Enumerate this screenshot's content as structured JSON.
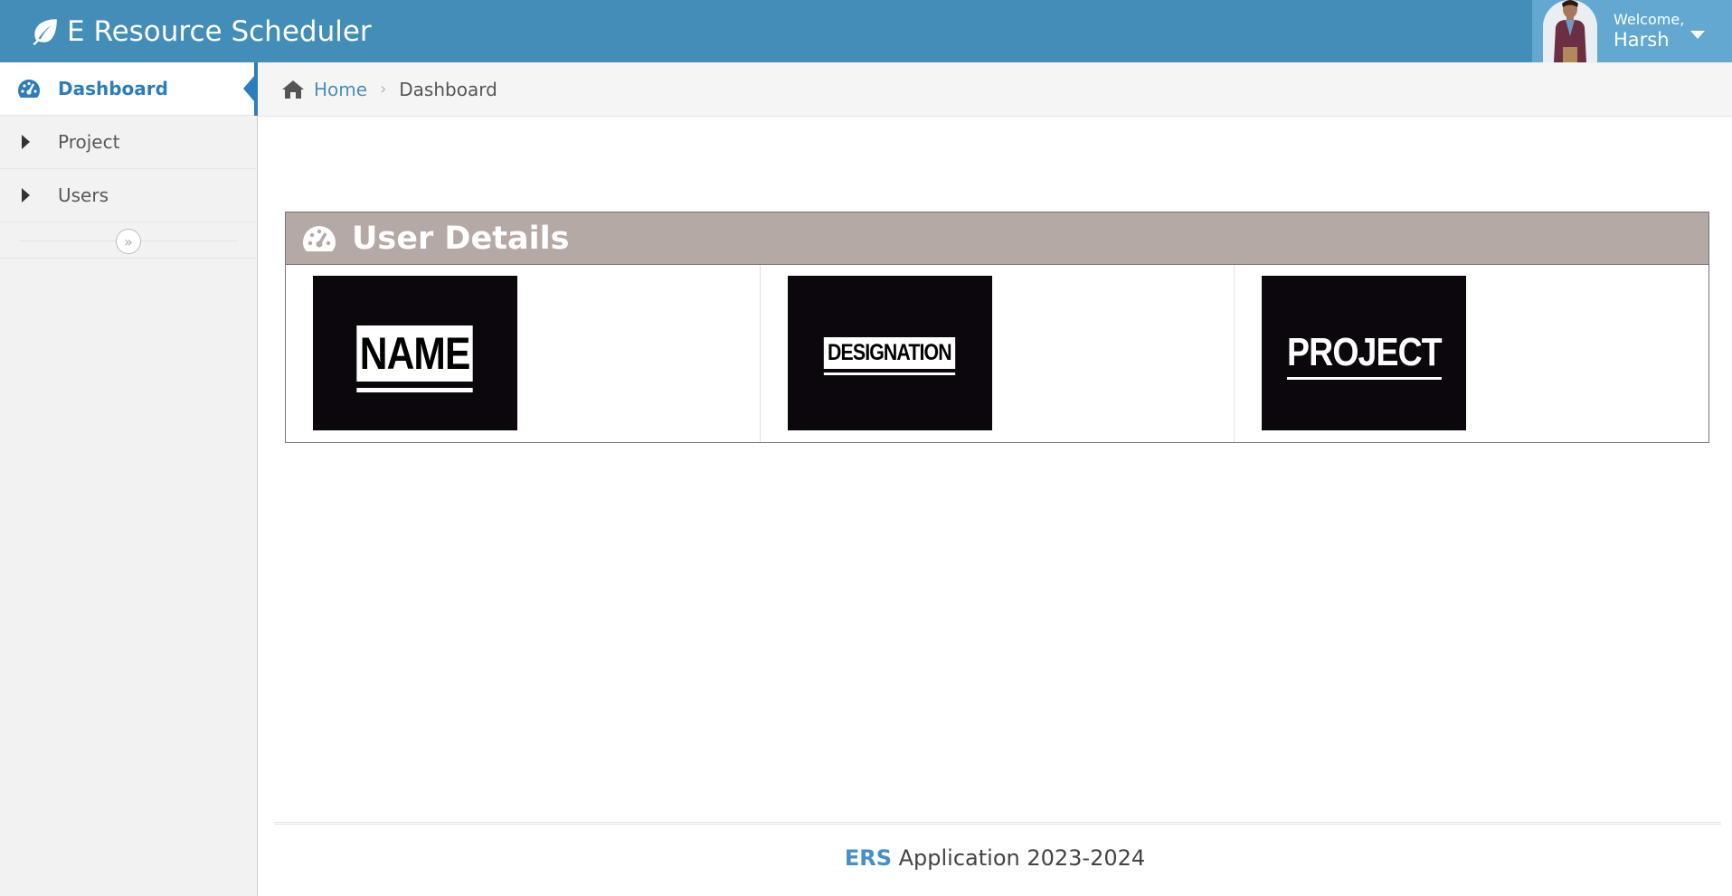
{
  "header": {
    "brand": "E Resource Scheduler",
    "welcome": "Welcome,",
    "user_name": "Harsh"
  },
  "sidebar": {
    "items": [
      {
        "label": "Dashboard",
        "icon": "tachometer-icon",
        "active": true
      },
      {
        "label": "Project",
        "icon": "caret-right-icon",
        "active": false
      },
      {
        "label": "Users",
        "icon": "caret-right-icon",
        "active": false
      }
    ],
    "collapse_glyph": "»"
  },
  "breadcrumb": {
    "home": "Home",
    "separator": "›",
    "current": "Dashboard"
  },
  "widget": {
    "title": "User Details",
    "tiles": [
      {
        "label": "NAME"
      },
      {
        "label": "DESIGNATION"
      },
      {
        "label": "PROJECT"
      }
    ]
  },
  "footer": {
    "brand": "ERS",
    "text": "Application 2023-2024"
  },
  "colors": {
    "navbar": "#438eb9",
    "user_menu": "#62a8d1",
    "accent": "#2b7dbc",
    "widget_header": "#b4a9a5",
    "tile_bg": "#0b070d"
  }
}
